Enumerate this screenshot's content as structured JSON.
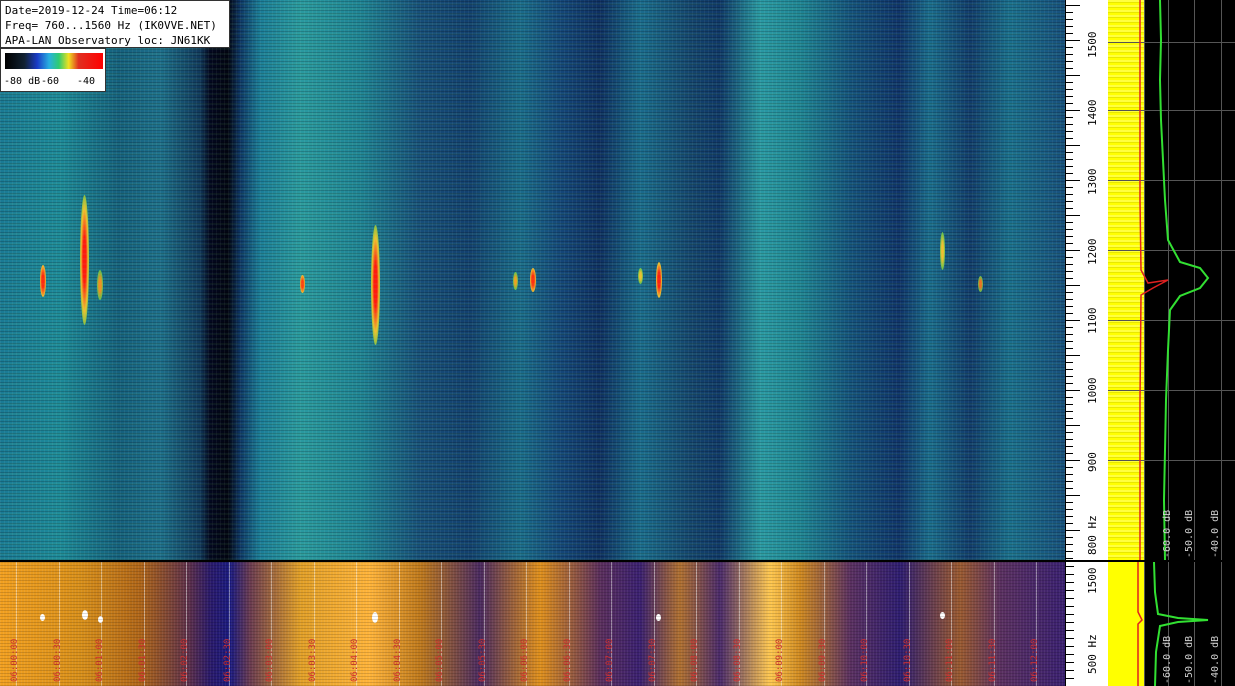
{
  "info": {
    "line1": "Date=2019-12-24 Time=06:12",
    "line2": "Freq= 760...1560 Hz (IK0VVE.NET)",
    "line3": "APA-LAN Observatory loc: JN61KK"
  },
  "scale": {
    "labels": [
      "-80 dB",
      "-60",
      "-40"
    ]
  },
  "freq_axis_main": {
    "ticks": [
      "1500",
      "1400",
      "1300",
      "1200",
      "1100",
      "1000",
      "900",
      "800 Hz"
    ]
  },
  "freq_axis_bottom": {
    "ticks": [
      "1500",
      "500 Hz"
    ]
  },
  "spectrum_main": {
    "db_labels": [
      "-60.0 dB",
      "-50.0 dB",
      "-40.0 dB"
    ]
  },
  "spectrum_bottom": {
    "db_labels": [
      "-60.0 dB",
      "-50.0 dB",
      "-40.0 dB"
    ]
  },
  "colors": {
    "info_bg": "#ffffff",
    "timestamp": "#d43030",
    "spectrum_yellow": "#ffff00",
    "spectrum_green": "#32e032",
    "spectrum_red": "#e02020"
  },
  "timestamps": [
    "06:00:00",
    "06:00:30",
    "06:01:00",
    "06:01:30",
    "06:02:00",
    "06:02:30",
    "06:03:00",
    "06:03:30",
    "06:04:00",
    "06:04:30",
    "06:05:00",
    "06:05:30",
    "06:06:00",
    "06:06:30",
    "06:07:00",
    "06:07:30",
    "06:08:00",
    "06:08:30",
    "06:09:00",
    "06:09:30",
    "06:10:00",
    "06:10:30",
    "06:11:00",
    "06:11:30",
    "06:12:00"
  ]
}
